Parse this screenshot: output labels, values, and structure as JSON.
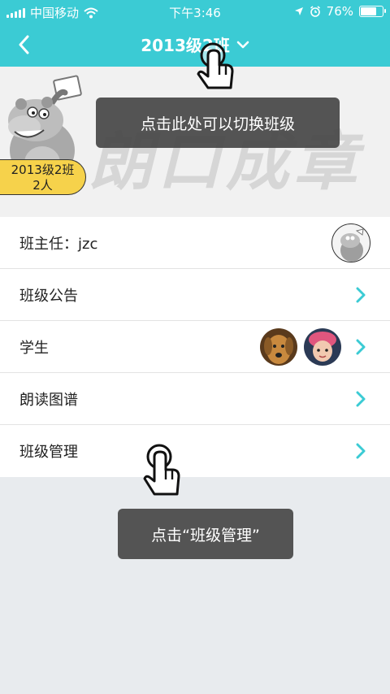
{
  "status_bar": {
    "carrier": "中国移动",
    "time": "下午3:46",
    "battery": "76%",
    "battery_level": 0.76
  },
  "nav": {
    "title": "2013级2班",
    "icons": [
      "back-chevron-icon",
      "dropdown-chevron-icon"
    ]
  },
  "banner": {
    "watermark": "朗口成章",
    "class_name": "2013级2班",
    "class_count": "2人"
  },
  "list": {
    "teacher": "班主任：jzc",
    "announcement": "班级公告",
    "students": "学生",
    "reading_map": "朗读图谱",
    "class_management": "班级管理"
  },
  "tips": {
    "switch_class": "点击此处可以切换班级",
    "click_manage": "点击“班级管理”"
  },
  "colors": {
    "accent": "#3bcbd4",
    "badge": "#f6d24b",
    "chevron": "#3bcbd4"
  }
}
